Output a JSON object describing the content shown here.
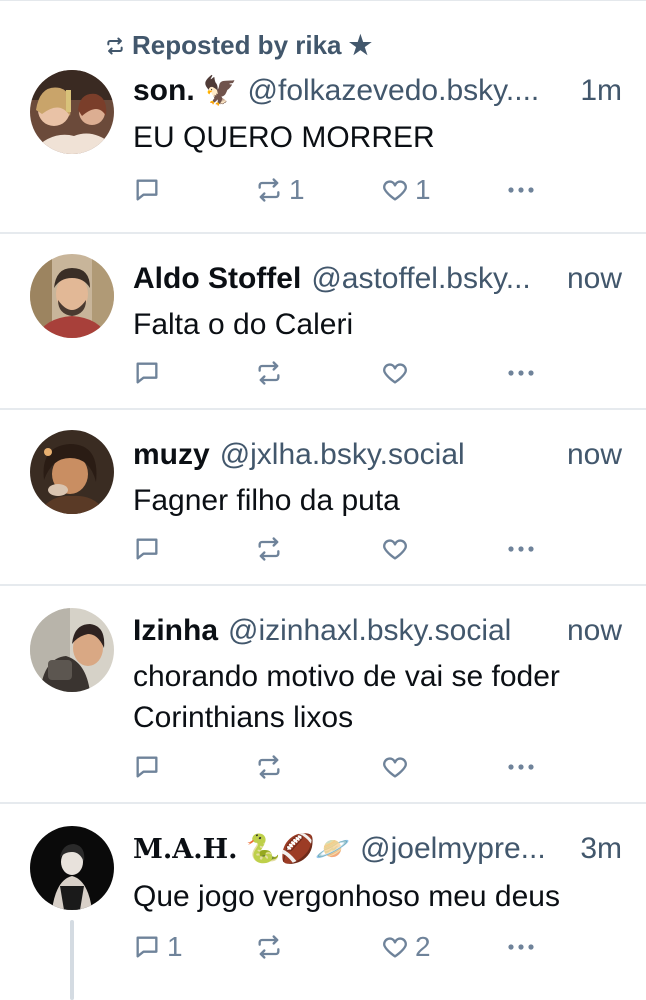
{
  "repost_banner": {
    "label": "Reposted by rika ★"
  },
  "posts": [
    {
      "name": "son.",
      "emoji": "🦅",
      "handle": "@folkazevedo.bsky....",
      "time": "1m",
      "text": "EU QUERO MORRER",
      "replies": "",
      "reposts": "1",
      "likes": "1"
    },
    {
      "name": "Aldo Stoffel",
      "emoji": "",
      "handle": "@astoffel.bsky...",
      "time": "now",
      "text": "Falta o do Caleri",
      "replies": "",
      "reposts": "",
      "likes": ""
    },
    {
      "name": "muzy",
      "emoji": "",
      "handle": "@jxlha.bsky.social",
      "time": "now",
      "text": "Fagner filho da puta",
      "replies": "",
      "reposts": "",
      "likes": ""
    },
    {
      "name": "Izinha",
      "emoji": "",
      "handle": "@izinhaxl.bsky.social",
      "time": "now",
      "text": "chorando motivo de vai se foder Corinthians lixos",
      "replies": "",
      "reposts": "",
      "likes": ""
    },
    {
      "name": "M.A.H.",
      "emoji": "🐍🏈🪐",
      "handle": "@joelmypre...",
      "time": "3m",
      "text": "Que jogo vergonhoso meu deus",
      "replies": "1",
      "reposts": "",
      "likes": "2"
    }
  ],
  "icons": {
    "repost_banner": "repost-icon",
    "reply": "reply-icon",
    "repost": "repost-icon",
    "like": "heart-icon",
    "more": "more-icon"
  },
  "colors": {
    "text": "#0b0f14",
    "secondary": "#42576c",
    "icon": "#6f839a",
    "divider": "#e6eaee"
  }
}
